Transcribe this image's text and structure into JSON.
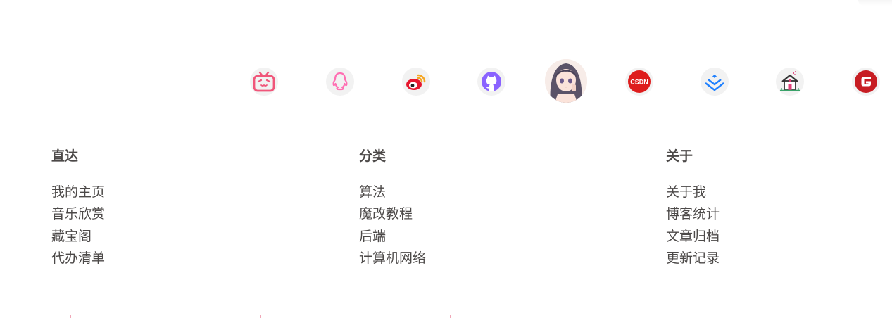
{
  "social": {
    "items": [
      {
        "icon": "bilibili-icon",
        "color": "#f0567a"
      },
      {
        "icon": "qq-icon",
        "color": "#ff6fb3"
      },
      {
        "icon": "weibo-icon",
        "color": "#e6162d"
      },
      {
        "icon": "github-icon",
        "color": "#8a63ff"
      },
      {
        "icon": "avatar"
      },
      {
        "icon": "csdn-icon",
        "color": "#de1d1d",
        "text": "CSDN"
      },
      {
        "icon": "juejin-icon",
        "color": "#1e80ff"
      },
      {
        "icon": "house-icon",
        "color": "#333333"
      },
      {
        "icon": "gitee-icon",
        "color": "#c71d23"
      }
    ]
  },
  "footer": {
    "direct": {
      "title": "直达",
      "links": [
        "我的主页",
        "音乐欣赏",
        "藏宝阁",
        "代办清单"
      ]
    },
    "category": {
      "title": "分类",
      "links": [
        "算法",
        "魔改教程",
        "后端",
        "计算机网络"
      ]
    },
    "about": {
      "title": "关于",
      "links": [
        "关于我",
        "博客统计",
        "文章归档",
        "更新记录"
      ]
    }
  }
}
